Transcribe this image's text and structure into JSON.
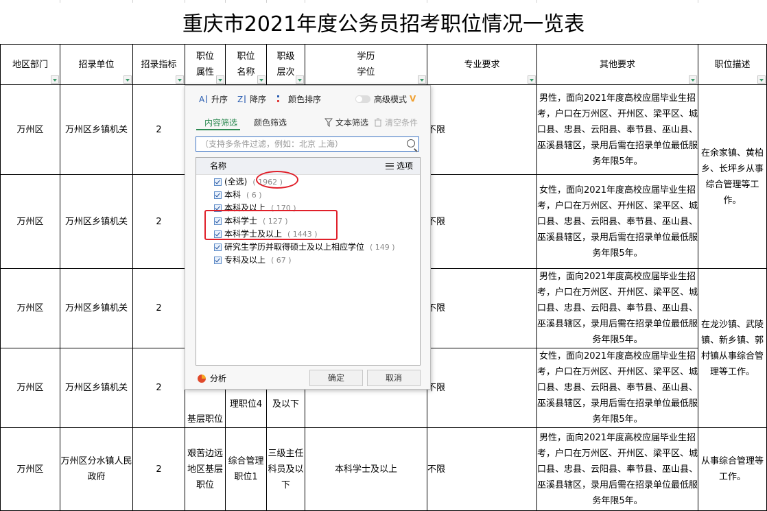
{
  "title": "重庆市2021年度公务员招考职位情况一览表",
  "headers": {
    "region": "地区部门",
    "unit": "招录单位",
    "quota": "招录指标",
    "attr": "职位属性",
    "name": "职位名称",
    "level": "职级层次",
    "edu": "学历学位",
    "major": "专业要求",
    "other": "其他要求",
    "desc": "职位描述"
  },
  "rows": [
    {
      "region": "万州区",
      "unit": "万州区乡镇机关",
      "quota": "2",
      "major": "不限",
      "other": "男性，面向2021年度高校应届毕业生招考，户口在万州区、开州区、梁平区、城口县、忠县、云阳县、奉节县、巫山县、巫溪县辖区，录用后需在招录单位最低服务年限5年。"
    },
    {
      "region": "万州区",
      "unit": "万州区乡镇机关",
      "quota": "2",
      "major": "不限",
      "other": "女性，面向2021年度高校应届毕业生招考，户口在万州区、开州区、梁平区、城口县、忠县、云阳县、奉节县、巫山县、巫溪县辖区，录用后需在招录单位最低服务年限5年。"
    },
    {
      "region": "万州区",
      "unit": "万州区乡镇机关",
      "quota": "2",
      "major": "不限",
      "other": "男性，面向2021年度高校应届毕业生招考，户口在万州区、开州区、梁平区、城口县、忠县、云阳县、奉节县、巫山县、巫溪县辖区，录用后需在招录单位最低服务年限5年。"
    },
    {
      "region": "万州区",
      "unit": "万州区乡镇机关",
      "quota": "2",
      "attr": "基层职位",
      "name": "理职位4",
      "level": "及以下",
      "major": "不限",
      "other": "女性，面向2021年度高校应届毕业生招考，户口在万州区、开州区、梁平区、城口县、忠县、云阳县、奉节县、巫山县、巫溪县辖区，录用后需在招录单位最低服务年限5年。"
    },
    {
      "region": "万州区",
      "unit": "万州区分水镇人民政府",
      "quota": "2",
      "attr": "艰苦边远地区基层职位",
      "name": "综合管理职位1",
      "level": "三级主任科员及以下",
      "edu": "本科学士及以上",
      "major": "不限",
      "other": "男性，面向2021年度高校应届毕业生招考，户口在万州区、开州区、梁平区、城口县、忠县、云阳县、奉节县、巫山县、巫溪县辖区，录用后需在招录单位最低服务年限5年。",
      "desc": "从事综合管理等工作。"
    }
  ],
  "desc_merged": {
    "a": "在余家镇、黄柏乡、长坪乡从事综合管理等工作。",
    "b": "在龙沙镇、武陵镇、新乡镇、郭村镇从事综合管理等工作。"
  },
  "filter": {
    "sort_asc": "升序",
    "sort_desc": "降序",
    "sort_color": "颜色排序",
    "advanced": "高级模式",
    "advanced_mark": "V",
    "tab_content": "内容筛选",
    "tab_color": "颜色筛选",
    "text_filter": "文本筛选",
    "clear": "清空条件",
    "search_placeholder": "（支持多条件过滤，例如：北京  上海）",
    "col_name": "名称",
    "options": "选项",
    "items": [
      {
        "label": "(全选)",
        "count": "( 1962 )"
      },
      {
        "label": "本科",
        "count": "( 6 )"
      },
      {
        "label": "本科及以上",
        "count": "( 170 )"
      },
      {
        "label": "本科学士",
        "count": "( 127 )"
      },
      {
        "label": "本科学士及以上",
        "count": "( 1443 )"
      },
      {
        "label": "研究生学历并取得硕士及以上相应学位",
        "count": "( 149 )"
      },
      {
        "label": "专科及以上",
        "count": "( 67 )"
      }
    ],
    "analysis": "分析",
    "ok": "确定",
    "cancel": "取消"
  },
  "colors": {
    "accent": "#2d8a52",
    "annotation": "#e0202a",
    "focus": "#3a72c4"
  }
}
